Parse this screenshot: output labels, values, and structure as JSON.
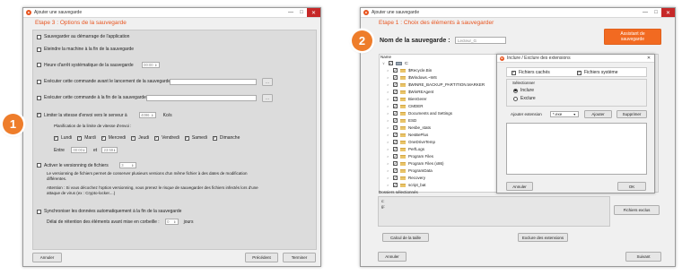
{
  "left": {
    "title": "Ajouter une sauvegarde",
    "step": "Etape 3 :   Options de la sauvegarde",
    "badge": "1",
    "opts": [
      {
        "label": "Sauvegarder au démarrage de l'application",
        "checked": false
      },
      {
        "label": "Eteindre la machine à la fin de la sauvegarde",
        "checked": false
      },
      {
        "label": "Heure d'arrêt systématique de la sauvegarde",
        "checked": false,
        "value": "00:00"
      },
      {
        "label": "Exécuter cette commande avant le lancement de la sauvegarde",
        "checked": false,
        "browse": "..."
      },
      {
        "label": "Exécuter cette commande à la fin de la sauvegarde",
        "checked": false,
        "browse": "..."
      },
      {
        "label": "Limiter la vitesse d'envoi vers le serveur à",
        "checked": true,
        "value": "4096",
        "unit": "Ko/s"
      }
    ],
    "plan_label": "Planification de la limite de vitesse d'envoi :",
    "days": [
      {
        "label": "Lundi",
        "checked": true
      },
      {
        "label": "Mardi",
        "checked": true
      },
      {
        "label": "Mercredi",
        "checked": true
      },
      {
        "label": "Jeudi",
        "checked": true
      },
      {
        "label": "Vendredi",
        "checked": true
      },
      {
        "label": "Samedi",
        "checked": true
      },
      {
        "label": "Dimanche",
        "checked": true
      }
    ],
    "between": "Entre",
    "from": "00:00",
    "and": "et",
    "to": "23:59",
    "version": {
      "label": "Activer le versionning de fichiers",
      "checked": false,
      "value": "3"
    },
    "version_desc": "Le versionning de fichiers permet de conserver plusieurs versions d'un même fichier à des dates de modification différentes.",
    "version_warn": "Attention : Si vous décochez l'option versionning, vous prenez le risque de sauvegarder des fichiers infectés lors d'une attaque de virus (ex : Crypto-locker....)",
    "sync": {
      "label": "Synchroniser les données automatiquement à la fin de la sauvegarde",
      "checked": false
    },
    "retention": {
      "label": "Délai de rétention des éléments avant mise en corbeille :",
      "value": "0",
      "unit": "jours"
    },
    "btn_cancel": "Annuler",
    "btn_prev": "Précédent",
    "btn_finish": "Terminer"
  },
  "right": {
    "title": "Ajouter une sauvegarde",
    "step": "Etape 1 :   Choix des éléments à sauvegarder",
    "badge": "2",
    "name_label": "Nom de la sauvegarde :",
    "name_value": "Lecteur_G",
    "assistant": "Assistant de sauvegarde",
    "col_name": "Name",
    "root": "C:",
    "folders": [
      "$Recycle.Bin",
      "$Windows.~WS",
      "$WINRE_BACKUP_PARTITION.MARKER",
      "$WinREAgent",
      "BienGerer",
      "CMDER",
      "Documents and Settings",
      "ESD",
      "Nesbe_stats",
      "NesBePlus",
      "OneDriveTemp",
      "PerfLogs",
      "Program Files",
      "Program Files (x86)",
      "ProgramData",
      "Recovery",
      "script_bat"
    ],
    "sel_label": "Dossiers sélectionnés",
    "sel_items": [
      "c:",
      "g:"
    ],
    "btn_excluded": "Fichiers exclus",
    "btn_size": "Calcul de la taille",
    "btn_exclude_ext": "Exclure des extensions",
    "btn_cancel": "Annuler",
    "btn_next": "Suivant",
    "dialog": {
      "title": "Inclure / Exclure des extensions",
      "hidden": {
        "label": "Fichiers cachés",
        "checked": true
      },
      "system": {
        "label": "Fichiers système",
        "checked": true
      },
      "select_label": "Sélectionner",
      "include": "Inclure",
      "exclude": "Exclure",
      "ext_label": "Ajouter extension",
      "ext_value": "*.exe",
      "add": "Ajouter",
      "remove": "Supprimer",
      "cancel": "Annuler",
      "ok": "OK"
    }
  }
}
